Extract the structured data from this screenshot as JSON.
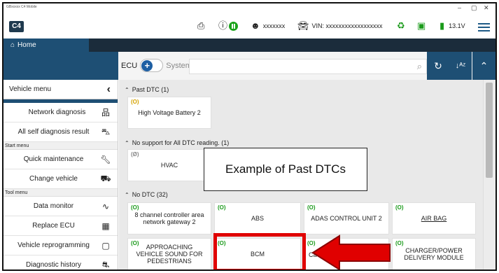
{
  "window": {
    "title": "GBxxxxx C4 Mobile",
    "controls": [
      "–",
      "▢",
      "✕"
    ]
  },
  "toolbar": {
    "logo": "C4",
    "user": "xxxxxxx",
    "vin": "VIN: xxxxxxxxxxxxxxxxxx",
    "battery": "13.1V"
  },
  "home_tab": {
    "label": "Home"
  },
  "subbar": {
    "ecu_label": "ECU",
    "system_label": "System",
    "search_placeholder": ""
  },
  "sidebar": {
    "title": "Vehicle menu",
    "items": [
      {
        "label": "Network diagnosis",
        "icon": "network-icon"
      },
      {
        "label": "All self diagnosis result",
        "icon": "car-search-icon"
      },
      {
        "section": "Start menu"
      },
      {
        "label": "Quick maintenance",
        "icon": "wrench-icon"
      },
      {
        "label": "Change vehicle",
        "icon": "car-front-icon"
      },
      {
        "section": "Tool menu"
      },
      {
        "label": "Data monitor",
        "icon": "waveform-icon"
      },
      {
        "label": "Replace ECU",
        "icon": "chip-icon"
      },
      {
        "label": "Vehicle reprogramming",
        "icon": "reprogram-icon"
      },
      {
        "label": "Diagnostic history",
        "icon": "car-history-icon"
      }
    ]
  },
  "groups": [
    {
      "label": "Past DTC (1)"
    },
    {
      "label": "No support for All DTC reading. (1)"
    },
    {
      "label": "No DTC (32)"
    }
  ],
  "cards": {
    "past": [
      {
        "name": "High Voltage Battery 2",
        "status": "(O)"
      }
    ],
    "unsupported": [
      {
        "name": "HVAC",
        "status": "(Ø)"
      }
    ],
    "nodtc": [
      {
        "name": "8 channel controller area network gateway 2",
        "status": "(O)"
      },
      {
        "name": "ABS",
        "status": "(O)"
      },
      {
        "name": "ADAS CONTROL UNIT 2",
        "status": "(O)"
      },
      {
        "name": "AIR BAG",
        "status": "(O)"
      },
      {
        "name": "APPROACHING VEHICLE SOUND FOR PEDESTRIANS",
        "status": "(O)"
      },
      {
        "name": "BCM",
        "status": "(O)"
      },
      {
        "name": "Ca",
        "status": "(O)"
      },
      {
        "name": "CHARGER/POWER DELIVERY MODULE",
        "status": "(O)"
      }
    ]
  },
  "callout": {
    "text": "Example of Past DTCs"
  },
  "colors": {
    "accent": "#1e4f74",
    "ok": "#1a9a1a",
    "past": "#d4a200",
    "highlight": "#e00000"
  }
}
